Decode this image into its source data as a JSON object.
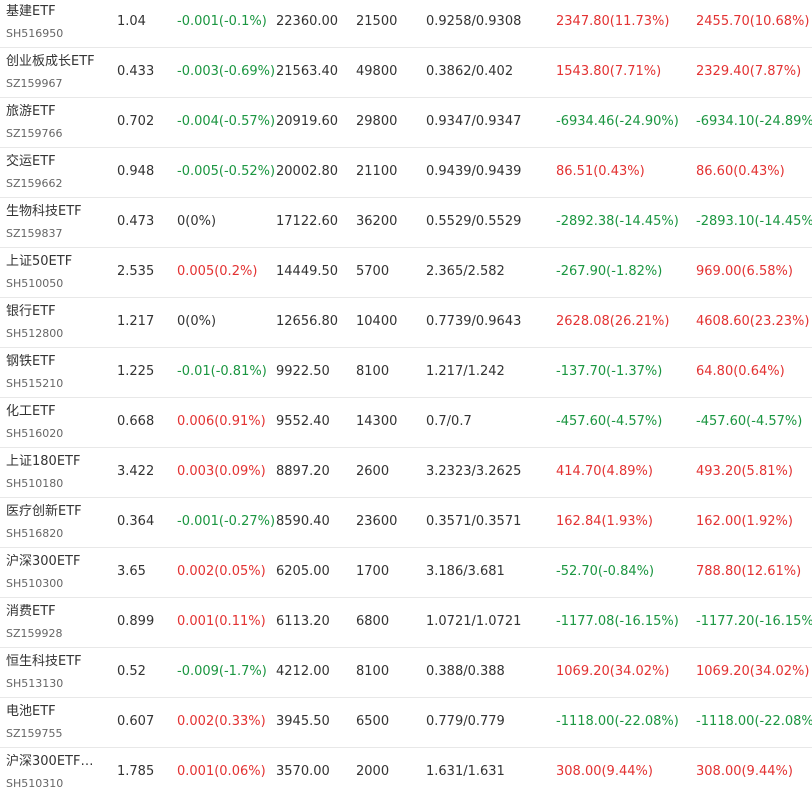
{
  "colors": {
    "up": "#e33232",
    "down": "#1b9641",
    "flat": "#333333",
    "text": "#333333",
    "subtext": "#666666",
    "divider": "#e8e8e8"
  },
  "rows": [
    {
      "name": "基建ETF",
      "code": "SH516950",
      "price": "1.04",
      "change": "-0.001(-0.1%)",
      "change_dir": "down",
      "amount": "22360.00",
      "volume": "21500",
      "range": "0.9258/0.9308",
      "val1": "2347.80(11.73%)",
      "val1_dir": "up",
      "val2": "2455.70(10.68%)",
      "val2_dir": "up"
    },
    {
      "name": "创业板成长ETF",
      "code": "SZ159967",
      "price": "0.433",
      "change": "-0.003(-0.69%)",
      "change_dir": "down",
      "amount": "21563.40",
      "volume": "49800",
      "range": "0.3862/0.402",
      "val1": "1543.80(7.71%)",
      "val1_dir": "up",
      "val2": "2329.40(7.87%)",
      "val2_dir": "up"
    },
    {
      "name": "旅游ETF",
      "code": "SZ159766",
      "price": "0.702",
      "change": "-0.004(-0.57%)",
      "change_dir": "down",
      "amount": "20919.60",
      "volume": "29800",
      "range": "0.9347/0.9347",
      "val1": "-6934.46(-24.90%)",
      "val1_dir": "down",
      "val2": "-6934.10(-24.89%)",
      "val2_dir": "down"
    },
    {
      "name": "交运ETF",
      "code": "SZ159662",
      "price": "0.948",
      "change": "-0.005(-0.52%)",
      "change_dir": "down",
      "amount": "20002.80",
      "volume": "21100",
      "range": "0.9439/0.9439",
      "val1": "86.51(0.43%)",
      "val1_dir": "up",
      "val2": "86.60(0.43%)",
      "val2_dir": "up"
    },
    {
      "name": "生物科技ETF",
      "code": "SZ159837",
      "price": "0.473",
      "change": "0(0%)",
      "change_dir": "flat",
      "amount": "17122.60",
      "volume": "36200",
      "range": "0.5529/0.5529",
      "val1": "-2892.38(-14.45%)",
      "val1_dir": "down",
      "val2": "-2893.10(-14.45%)",
      "val2_dir": "down"
    },
    {
      "name": "上证50ETF",
      "code": "SH510050",
      "price": "2.535",
      "change": "0.005(0.2%)",
      "change_dir": "up",
      "amount": "14449.50",
      "volume": "5700",
      "range": "2.365/2.582",
      "val1": "-267.90(-1.82%)",
      "val1_dir": "down",
      "val2": "969.00(6.58%)",
      "val2_dir": "up"
    },
    {
      "name": "银行ETF",
      "code": "SH512800",
      "price": "1.217",
      "change": "0(0%)",
      "change_dir": "flat",
      "amount": "12656.80",
      "volume": "10400",
      "range": "0.7739/0.9643",
      "val1": "2628.08(26.21%)",
      "val1_dir": "up",
      "val2": "4608.60(23.23%)",
      "val2_dir": "up"
    },
    {
      "name": "钢铁ETF",
      "code": "SH515210",
      "price": "1.225",
      "change": "-0.01(-0.81%)",
      "change_dir": "down",
      "amount": "9922.50",
      "volume": "8100",
      "range": "1.217/1.242",
      "val1": "-137.70(-1.37%)",
      "val1_dir": "down",
      "val2": "64.80(0.64%)",
      "val2_dir": "up"
    },
    {
      "name": "化工ETF",
      "code": "SH516020",
      "price": "0.668",
      "change": "0.006(0.91%)",
      "change_dir": "up",
      "amount": "9552.40",
      "volume": "14300",
      "range": "0.7/0.7",
      "val1": "-457.60(-4.57%)",
      "val1_dir": "down",
      "val2": "-457.60(-4.57%)",
      "val2_dir": "down"
    },
    {
      "name": "上证180ETF",
      "code": "SH510180",
      "price": "3.422",
      "change": "0.003(0.09%)",
      "change_dir": "up",
      "amount": "8897.20",
      "volume": "2600",
      "range": "3.2323/3.2625",
      "val1": "414.70(4.89%)",
      "val1_dir": "up",
      "val2": "493.20(5.81%)",
      "val2_dir": "up"
    },
    {
      "name": "医疗创新ETF",
      "code": "SH516820",
      "price": "0.364",
      "change": "-0.001(-0.27%)",
      "change_dir": "down",
      "amount": "8590.40",
      "volume": "23600",
      "range": "0.3571/0.3571",
      "val1": "162.84(1.93%)",
      "val1_dir": "up",
      "val2": "162.00(1.92%)",
      "val2_dir": "up"
    },
    {
      "name": "沪深300ETF",
      "code": "SH510300",
      "price": "3.65",
      "change": "0.002(0.05%)",
      "change_dir": "up",
      "amount": "6205.00",
      "volume": "1700",
      "range": "3.186/3.681",
      "val1": "-52.70(-0.84%)",
      "val1_dir": "down",
      "val2": "788.80(12.61%)",
      "val2_dir": "up"
    },
    {
      "name": "消费ETF",
      "code": "SZ159928",
      "price": "0.899",
      "change": "0.001(0.11%)",
      "change_dir": "up",
      "amount": "6113.20",
      "volume": "6800",
      "range": "1.0721/1.0721",
      "val1": "-1177.08(-16.15%)",
      "val1_dir": "down",
      "val2": "-1177.20(-16.15%)",
      "val2_dir": "down"
    },
    {
      "name": "恒生科技ETF",
      "code": "SH513130",
      "price": "0.52",
      "change": "-0.009(-1.7%)",
      "change_dir": "down",
      "amount": "4212.00",
      "volume": "8100",
      "range": "0.388/0.388",
      "val1": "1069.20(34.02%)",
      "val1_dir": "up",
      "val2": "1069.20(34.02%)",
      "val2_dir": "up"
    },
    {
      "name": "电池ETF",
      "code": "SZ159755",
      "price": "0.607",
      "change": "0.002(0.33%)",
      "change_dir": "up",
      "amount": "3945.50",
      "volume": "6500",
      "range": "0.779/0.779",
      "val1": "-1118.00(-22.08%)",
      "val1_dir": "down",
      "val2": "-1118.00(-22.08%)",
      "val2_dir": "down"
    },
    {
      "name": "沪深300ETF…",
      "code": "SH510310",
      "price": "1.785",
      "change": "0.001(0.06%)",
      "change_dir": "up",
      "amount": "3570.00",
      "volume": "2000",
      "range": "1.631/1.631",
      "val1": "308.00(9.44%)",
      "val1_dir": "up",
      "val2": "308.00(9.44%)",
      "val2_dir": "up"
    }
  ]
}
